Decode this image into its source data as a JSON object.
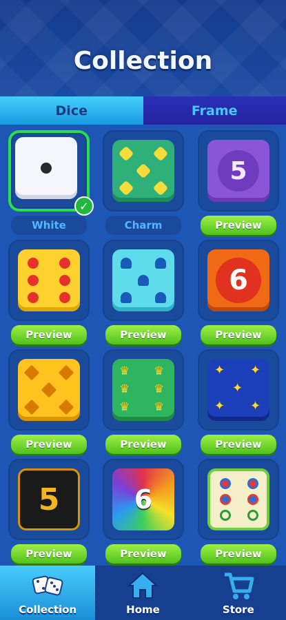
{
  "header": {
    "title": "Collection"
  },
  "tabs": [
    {
      "label": "Dice",
      "active": true
    },
    {
      "label": "Frame",
      "active": false
    }
  ],
  "items": [
    {
      "caption": "White",
      "caption_type": "name",
      "selected": true,
      "die": "white-one-pip"
    },
    {
      "caption": "Charm",
      "caption_type": "name",
      "selected": false,
      "die": "green-clover-five"
    },
    {
      "caption": "Preview",
      "caption_type": "button",
      "selected": false,
      "die": "purple-five",
      "face_number": "5"
    },
    {
      "caption": "Preview",
      "caption_type": "button",
      "selected": false,
      "die": "yellow-red-six"
    },
    {
      "caption": "Preview",
      "caption_type": "button",
      "selected": false,
      "die": "cyan-shell-five"
    },
    {
      "caption": "Preview",
      "caption_type": "button",
      "selected": false,
      "die": "orange-six",
      "face_number": "6"
    },
    {
      "caption": "Preview",
      "caption_type": "button",
      "selected": false,
      "die": "gold-diamond-five"
    },
    {
      "caption": "Preview",
      "caption_type": "button",
      "selected": false,
      "die": "green-crown-six"
    },
    {
      "caption": "Preview",
      "caption_type": "button",
      "selected": false,
      "die": "blue-star-five"
    },
    {
      "caption": "Preview",
      "caption_type": "button",
      "selected": false,
      "die": "black-gold-five",
      "face_number": "5"
    },
    {
      "caption": "Preview",
      "caption_type": "button",
      "selected": false,
      "die": "rainbow-six",
      "face_number": "6"
    },
    {
      "caption": "Preview",
      "caption_type": "button",
      "selected": false,
      "die": "cream-target-six"
    }
  ],
  "nav": [
    {
      "label": "Collection",
      "icon": "dice-icon",
      "active": true
    },
    {
      "label": "Home",
      "icon": "home-icon",
      "active": false
    },
    {
      "label": "Store",
      "icon": "cart-icon",
      "active": false
    }
  ],
  "colors": {
    "accent_green": "#27e04b",
    "background_blue": "#1b4fa8",
    "tab_active": "#42d0fb"
  }
}
